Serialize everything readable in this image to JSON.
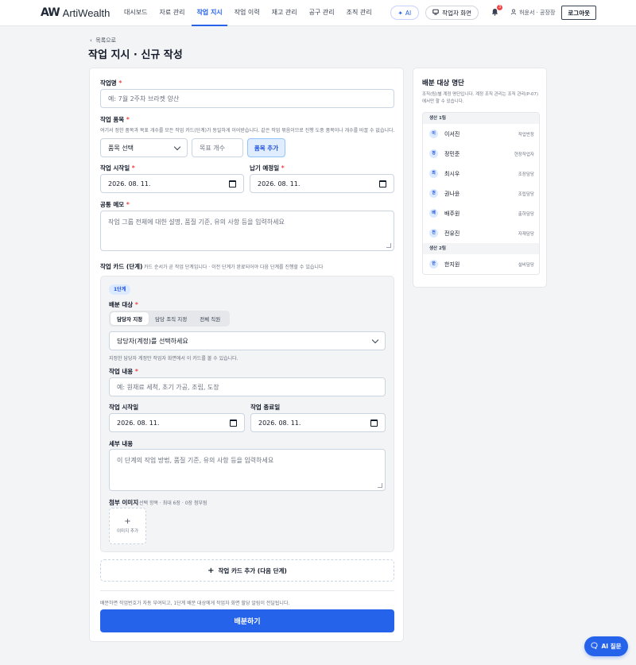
{
  "header": {
    "logo_mark": "AW",
    "logo_text": "ArtiWealth",
    "nav": [
      "대시보드",
      "자료 관리",
      "작업 지시",
      "작업 이력",
      "재고 관리",
      "공구 관리",
      "조직 관리"
    ],
    "active_nav": "작업 지시",
    "ai_button": "AI",
    "worker_view_button": "작업자 화면",
    "notification_count": "3",
    "user_label": "허윤서 · 공장장",
    "logout_button": "로그아웃"
  },
  "page": {
    "back_link": "목록으로",
    "title": "작업 지시 · 신규 작성"
  },
  "form": {
    "task_name": {
      "label": "작업명",
      "placeholder": "예: 7월 2주차 브라켓 양산"
    },
    "items": {
      "label": "작업 품목",
      "help": "여기서 정한 품목과 목표 개수를 모든 작업 카드(단계)가 동일하게 이어받습니다. 같은 작업 묶음이므로 진행 도중 품목이나 개수를 바꿀 수 없습니다.",
      "select_value": "품목 선택",
      "qty_placeholder": "목표 개수",
      "add_button": "품목 추가"
    },
    "start_date": {
      "label": "작업 시작일",
      "value": "2026. 08. 11."
    },
    "due_date": {
      "label": "납기 예정일",
      "value": "2026. 08. 11."
    },
    "memo": {
      "label": "공통 메모",
      "placeholder": "작업 그룹 전체에 대한 설명, 품질 기준, 유의 사항 등을 입력하세요"
    },
    "cards": {
      "label": "작업 카드 (단계)",
      "help": "카드 순서가 곧 작업 단계입니다 · 이전 단계가 완료되어야 다음 단계를 진행할 수 있습니다"
    },
    "stage": {
      "badge": "1단계",
      "assign_label": "배분 대상",
      "tabs": [
        "담당자 지정",
        "담당 조직 지정",
        "전체 직원"
      ],
      "active_tab": "담당자 지정",
      "assignee_select": "담당자(계정)를 선택하세요",
      "assignee_help": "지정한 담당자 계정만 작업자 화면에서 이 카드를 볼 수 있습니다.",
      "content": {
        "label": "작업 내용",
        "placeholder": "예: 원재료 세척, 초기 가공, 조립, 도장"
      },
      "start": {
        "label": "작업 시작일",
        "value": "2026. 08. 11."
      },
      "end": {
        "label": "작업 종료일",
        "value": "2026. 08. 11."
      },
      "detail": {
        "label": "세부 내용",
        "placeholder": "이 단계의 작업 방법, 품질 기준, 유의 사항 등을 입력하세요"
      },
      "images": {
        "label": "첨부 이미지",
        "help": "선택 항목 · 최대 6장 · 0장 첨부됨",
        "upload_label": "이미지 추가"
      }
    },
    "add_card_button": "작업 카드 추가 (다음 단계)",
    "submit_note": "배분하면 작업번호가 자동 부여되고, 1단계 배분 대상에게 작업자 화면 할당 알림이 전달됩니다.",
    "submit_button": "배분하기"
  },
  "roster": {
    "title": "배분 대상 명단",
    "desc": "조직(팀)별 계정 명단입니다. 계정 조직 관리는 조직 관리(P-07)에서만 할 수 있습니다.",
    "groups": [
      {
        "name": "생산 1팀",
        "people": [
          {
            "initial": "이",
            "name": "이서진",
            "role": "작업반장"
          },
          {
            "initial": "정",
            "name": "정민준",
            "role": "현장작업자"
          },
          {
            "initial": "최",
            "name": "최시우",
            "role": "조장담당"
          },
          {
            "initial": "권",
            "name": "권나윤",
            "role": "조립담당"
          },
          {
            "initial": "배",
            "name": "배주원",
            "role": "출하담당"
          },
          {
            "initial": "전",
            "name": "전유진",
            "role": "자재담당"
          }
        ]
      },
      {
        "name": "생산 2팀",
        "people": [
          {
            "initial": "한",
            "name": "한지원",
            "role": "설비담당"
          }
        ]
      }
    ]
  },
  "fab_label": "AI 질문",
  "colors": {
    "primary": "#2563eb",
    "required": "#ef4444",
    "badge_bg": "#dbeafe"
  }
}
